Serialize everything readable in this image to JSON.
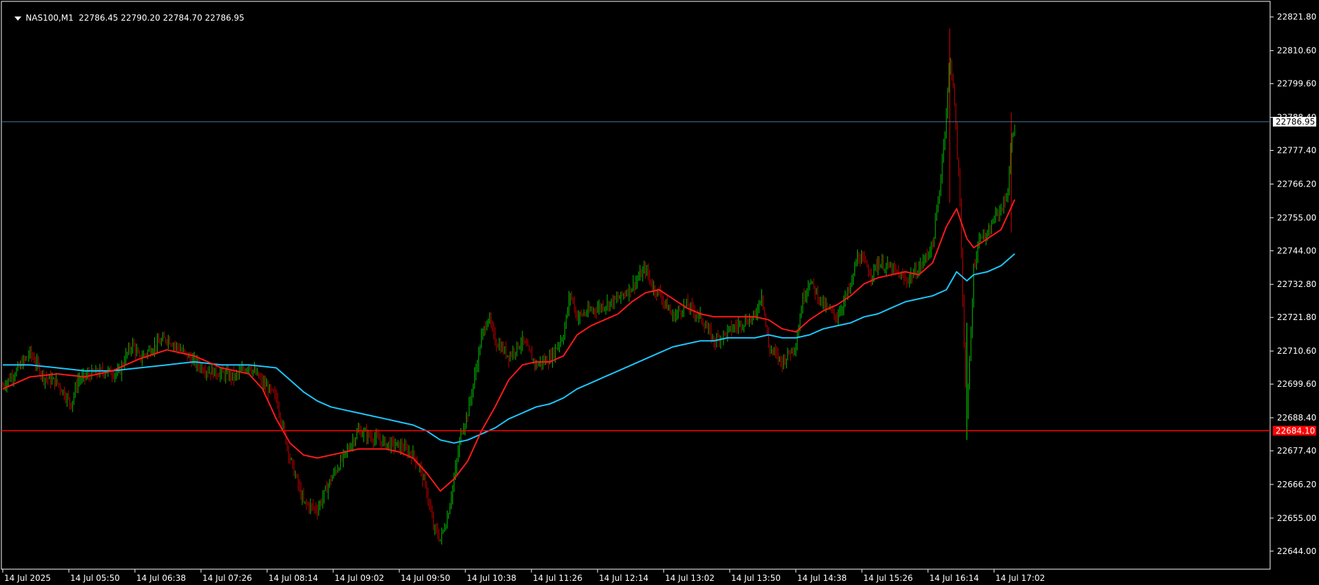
{
  "header": {
    "symbol": "NAS100,M1",
    "ohlc": "22786.45 22790.20 22784.70 22786.95"
  },
  "colors": {
    "background": "#000000",
    "frame": "#ffffff",
    "bull": "#00c000",
    "bear": "#c00000",
    "ma_fast": "#ff1a1a",
    "ma_slow": "#1ec8ff",
    "hline_upper": "#4a7aa0",
    "hline_lower": "#ff0000",
    "label_current_bg": "#ffffff",
    "label_lower_bg": "#ff0000"
  },
  "chart_data": {
    "type": "line",
    "price_range": [
      22638,
      22827
    ],
    "y_ticks": [
      "22821.80",
      "22810.60",
      "22799.60",
      "22788.40",
      "22777.40",
      "22766.20",
      "22755.00",
      "22744.00",
      "22732.80",
      "22721.80",
      "22710.60",
      "22699.60",
      "22688.40",
      "22677.40",
      "22666.20",
      "22655.00",
      "22644.00"
    ],
    "x_ticks": [
      "14 Jul 2025",
      "14 Jul 05:50",
      "14 Jul 06:38",
      "14 Jul 07:26",
      "14 Jul 08:14",
      "14 Jul 09:02",
      "14 Jul 09:50",
      "14 Jul 10:38",
      "14 Jul 11:26",
      "14 Jul 12:14",
      "14 Jul 13:02",
      "14 Jul 13:50",
      "14 Jul 14:38",
      "14 Jul 15:26",
      "14 Jul 16:14",
      "14 Jul 17:02"
    ],
    "hlines": [
      {
        "name": "current-price-line",
        "value": 22786.95,
        "label": "22786.95"
      },
      {
        "name": "lower-level-line",
        "value": 22684.1,
        "label": "22684.10"
      }
    ],
    "price_path": [
      [
        0,
        22699
      ],
      [
        20,
        22704
      ],
      [
        40,
        22710
      ],
      [
        60,
        22702
      ],
      [
        80,
        22700
      ],
      [
        100,
        22693
      ],
      [
        110,
        22701
      ],
      [
        130,
        22703
      ],
      [
        150,
        22704
      ],
      [
        170,
        22703
      ],
      [
        180,
        22709
      ],
      [
        190,
        22713
      ],
      [
        200,
        22708
      ],
      [
        220,
        22712
      ],
      [
        240,
        22715
      ],
      [
        260,
        22711
      ],
      [
        280,
        22707
      ],
      [
        300,
        22704
      ],
      [
        320,
        22703
      ],
      [
        340,
        22702
      ],
      [
        360,
        22706
      ],
      [
        380,
        22700
      ],
      [
        400,
        22695
      ],
      [
        420,
        22675
      ],
      [
        440,
        22660
      ],
      [
        460,
        22658
      ],
      [
        480,
        22668
      ],
      [
        500,
        22676
      ],
      [
        520,
        22684
      ],
      [
        540,
        22682
      ],
      [
        560,
        22680
      ],
      [
        580,
        22679
      ],
      [
        600,
        22676
      ],
      [
        610,
        22672
      ],
      [
        620,
        22664
      ],
      [
        630,
        22652
      ],
      [
        640,
        22648
      ],
      [
        650,
        22655
      ],
      [
        660,
        22668
      ],
      [
        670,
        22683
      ],
      [
        680,
        22690
      ],
      [
        690,
        22702
      ],
      [
        700,
        22715
      ],
      [
        710,
        22722
      ],
      [
        720,
        22714
      ],
      [
        740,
        22709
      ],
      [
        760,
        22714
      ],
      [
        780,
        22706
      ],
      [
        800,
        22708
      ],
      [
        820,
        22716
      ],
      [
        830,
        22730
      ],
      [
        840,
        22722
      ],
      [
        860,
        22724
      ],
      [
        880,
        22726
      ],
      [
        900,
        22728
      ],
      [
        920,
        22732
      ],
      [
        940,
        22738
      ],
      [
        950,
        22732
      ],
      [
        960,
        22730
      ],
      [
        980,
        22722
      ],
      [
        1000,
        22726
      ],
      [
        1020,
        22722
      ],
      [
        1040,
        22714
      ],
      [
        1060,
        22717
      ],
      [
        1080,
        22720
      ],
      [
        1100,
        22722
      ],
      [
        1110,
        22730
      ],
      [
        1120,
        22712
      ],
      [
        1140,
        22707
      ],
      [
        1160,
        22713
      ],
      [
        1170,
        22728
      ],
      [
        1180,
        22734
      ],
      [
        1200,
        22726
      ],
      [
        1220,
        22722
      ],
      [
        1240,
        22732
      ],
      [
        1250,
        22742
      ],
      [
        1260,
        22740
      ],
      [
        1270,
        22736
      ],
      [
        1280,
        22740
      ],
      [
        1300,
        22738
      ],
      [
        1320,
        22734
      ],
      [
        1340,
        22738
      ],
      [
        1360,
        22746
      ],
      [
        1370,
        22764
      ],
      [
        1380,
        22790
      ],
      [
        1385,
        22808
      ],
      [
        1390,
        22800
      ],
      [
        1400,
        22760
      ],
      [
        1405,
        22720
      ],
      [
        1410,
        22688
      ],
      [
        1415,
        22712
      ],
      [
        1420,
        22738
      ],
      [
        1430,
        22750
      ],
      [
        1440,
        22748
      ],
      [
        1450,
        22755
      ],
      [
        1460,
        22758
      ],
      [
        1465,
        22760
      ],
      [
        1470,
        22764
      ],
      [
        1475,
        22780
      ],
      [
        1480,
        22787
      ]
    ],
    "ma_fast": [
      [
        0,
        22698
      ],
      [
        40,
        22702
      ],
      [
        80,
        22703
      ],
      [
        120,
        22702
      ],
      [
        160,
        22704
      ],
      [
        200,
        22708
      ],
      [
        240,
        22711
      ],
      [
        280,
        22709
      ],
      [
        320,
        22705
      ],
      [
        360,
        22703
      ],
      [
        380,
        22698
      ],
      [
        400,
        22688
      ],
      [
        420,
        22680
      ],
      [
        440,
        22676
      ],
      [
        460,
        22675
      ],
      [
        480,
        22676
      ],
      [
        500,
        22677
      ],
      [
        520,
        22678
      ],
      [
        540,
        22678
      ],
      [
        560,
        22678
      ],
      [
        580,
        22677
      ],
      [
        600,
        22675
      ],
      [
        620,
        22670
      ],
      [
        640,
        22664
      ],
      [
        660,
        22668
      ],
      [
        680,
        22674
      ],
      [
        700,
        22684
      ],
      [
        720,
        22692
      ],
      [
        740,
        22701
      ],
      [
        760,
        22706
      ],
      [
        780,
        22707
      ],
      [
        800,
        22707
      ],
      [
        820,
        22709
      ],
      [
        840,
        22716
      ],
      [
        860,
        22719
      ],
      [
        880,
        22721
      ],
      [
        900,
        22723
      ],
      [
        920,
        22727
      ],
      [
        940,
        22730
      ],
      [
        960,
        22731
      ],
      [
        980,
        22728
      ],
      [
        1000,
        22725
      ],
      [
        1020,
        22723
      ],
      [
        1040,
        22722
      ],
      [
        1060,
        22722
      ],
      [
        1080,
        22722
      ],
      [
        1100,
        22722
      ],
      [
        1120,
        22721
      ],
      [
        1140,
        22718
      ],
      [
        1160,
        22717
      ],
      [
        1180,
        22721
      ],
      [
        1200,
        22724
      ],
      [
        1220,
        22726
      ],
      [
        1240,
        22729
      ],
      [
        1260,
        22733
      ],
      [
        1280,
        22735
      ],
      [
        1300,
        22736
      ],
      [
        1320,
        22737
      ],
      [
        1340,
        22736
      ],
      [
        1360,
        22740
      ],
      [
        1380,
        22752
      ],
      [
        1395,
        22758
      ],
      [
        1410,
        22748
      ],
      [
        1420,
        22745
      ],
      [
        1440,
        22748
      ],
      [
        1460,
        22751
      ],
      [
        1480,
        22761
      ]
    ],
    "ma_slow": [
      [
        0,
        22706
      ],
      [
        40,
        22706
      ],
      [
        80,
        22705
      ],
      [
        120,
        22704
      ],
      [
        160,
        22704
      ],
      [
        200,
        22705
      ],
      [
        240,
        22706
      ],
      [
        280,
        22707
      ],
      [
        320,
        22706
      ],
      [
        360,
        22706
      ],
      [
        400,
        22705
      ],
      [
        420,
        22701
      ],
      [
        440,
        22697
      ],
      [
        460,
        22694
      ],
      [
        480,
        22692
      ],
      [
        500,
        22691
      ],
      [
        520,
        22690
      ],
      [
        540,
        22689
      ],
      [
        560,
        22688
      ],
      [
        580,
        22687
      ],
      [
        600,
        22686
      ],
      [
        620,
        22684
      ],
      [
        640,
        22681
      ],
      [
        660,
        22680
      ],
      [
        680,
        22681
      ],
      [
        700,
        22683
      ],
      [
        720,
        22685
      ],
      [
        740,
        22688
      ],
      [
        760,
        22690
      ],
      [
        780,
        22692
      ],
      [
        800,
        22693
      ],
      [
        820,
        22695
      ],
      [
        840,
        22698
      ],
      [
        860,
        22700
      ],
      [
        880,
        22702
      ],
      [
        900,
        22704
      ],
      [
        920,
        22706
      ],
      [
        940,
        22708
      ],
      [
        960,
        22710
      ],
      [
        980,
        22712
      ],
      [
        1000,
        22713
      ],
      [
        1020,
        22714
      ],
      [
        1040,
        22714
      ],
      [
        1060,
        22715
      ],
      [
        1080,
        22715
      ],
      [
        1100,
        22715
      ],
      [
        1120,
        22716
      ],
      [
        1140,
        22715
      ],
      [
        1160,
        22715
      ],
      [
        1180,
        22716
      ],
      [
        1200,
        22718
      ],
      [
        1220,
        22719
      ],
      [
        1240,
        22720
      ],
      [
        1260,
        22722
      ],
      [
        1280,
        22723
      ],
      [
        1300,
        22725
      ],
      [
        1320,
        22727
      ],
      [
        1340,
        22728
      ],
      [
        1360,
        22729
      ],
      [
        1380,
        22731
      ],
      [
        1395,
        22737
      ],
      [
        1410,
        22734
      ],
      [
        1420,
        22736
      ],
      [
        1440,
        22737
      ],
      [
        1460,
        22739
      ],
      [
        1480,
        22743
      ]
    ],
    "spikes": [
      {
        "x": 1385,
        "high": 22818,
        "low": 22760
      },
      {
        "x": 1410,
        "high": 22720,
        "low": 22681
      },
      {
        "x": 1475,
        "high": 22790,
        "low": 22750
      }
    ]
  }
}
